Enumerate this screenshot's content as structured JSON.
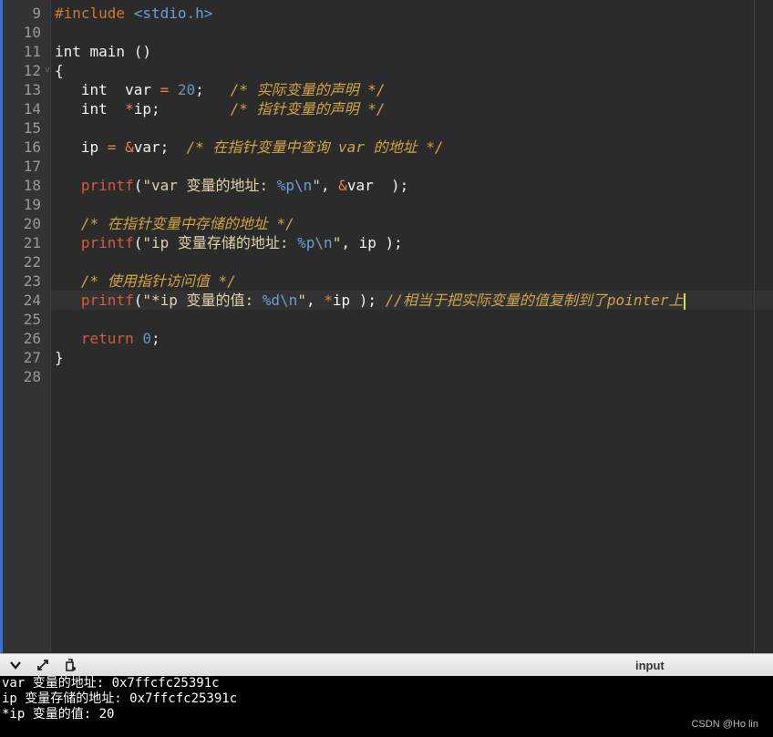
{
  "editor": {
    "lines": [
      {
        "n": "9",
        "segs": [
          {
            "c": "pp",
            "t": "#include "
          },
          {
            "c": "esc",
            "t": "<stdio.h>"
          }
        ]
      },
      {
        "n": "10",
        "segs": []
      },
      {
        "n": "11",
        "segs": [
          {
            "c": "kw",
            "t": "int main ()"
          }
        ]
      },
      {
        "n": "12",
        "fold": true,
        "segs": [
          {
            "c": "kw",
            "t": "{"
          }
        ]
      },
      {
        "n": "13",
        "segs": [
          {
            "c": "kw",
            "t": "   int  var "
          },
          {
            "c": "op",
            "t": "="
          },
          {
            "c": "kw",
            "t": " "
          },
          {
            "c": "num",
            "t": "20"
          },
          {
            "c": "kw",
            "t": ";   "
          },
          {
            "c": "cm",
            "t": "/* 实际变量的声明 */"
          }
        ]
      },
      {
        "n": "14",
        "segs": [
          {
            "c": "kw",
            "t": "   int  "
          },
          {
            "c": "op",
            "t": "*"
          },
          {
            "c": "kw",
            "t": "ip;        "
          },
          {
            "c": "cm",
            "t": "/* 指针变量的声明 */"
          }
        ]
      },
      {
        "n": "15",
        "segs": []
      },
      {
        "n": "16",
        "segs": [
          {
            "c": "kw",
            "t": "   ip "
          },
          {
            "c": "op",
            "t": "="
          },
          {
            "c": "kw",
            "t": " "
          },
          {
            "c": "op",
            "t": "&"
          },
          {
            "c": "kw",
            "t": "var;  "
          },
          {
            "c": "cm",
            "t": "/* 在指针变量中查询 var 的地址 */"
          }
        ]
      },
      {
        "n": "17",
        "segs": []
      },
      {
        "n": "18",
        "segs": [
          {
            "c": "kw",
            "t": "   "
          },
          {
            "c": "fn",
            "t": "printf"
          },
          {
            "c": "kw",
            "t": "("
          },
          {
            "c": "str",
            "t": "\"var 变量的地址: "
          },
          {
            "c": "esc",
            "t": "%p\\n"
          },
          {
            "c": "str",
            "t": "\""
          },
          {
            "c": "kw",
            "t": ", "
          },
          {
            "c": "op",
            "t": "&"
          },
          {
            "c": "kw",
            "t": "var  );"
          }
        ]
      },
      {
        "n": "19",
        "segs": []
      },
      {
        "n": "20",
        "segs": [
          {
            "c": "kw",
            "t": "   "
          },
          {
            "c": "cm",
            "t": "/* 在指针变量中存储的地址 */"
          }
        ]
      },
      {
        "n": "21",
        "segs": [
          {
            "c": "kw",
            "t": "   "
          },
          {
            "c": "fn",
            "t": "printf"
          },
          {
            "c": "kw",
            "t": "("
          },
          {
            "c": "str",
            "t": "\"ip 变量存储的地址: "
          },
          {
            "c": "esc",
            "t": "%p\\n"
          },
          {
            "c": "str",
            "t": "\""
          },
          {
            "c": "kw",
            "t": ", ip );"
          }
        ]
      },
      {
        "n": "22",
        "segs": []
      },
      {
        "n": "23",
        "segs": [
          {
            "c": "kw",
            "t": "   "
          },
          {
            "c": "cm",
            "t": "/* 使用指针访问值 */"
          }
        ]
      },
      {
        "n": "24",
        "cursor": true,
        "segs": [
          {
            "c": "kw",
            "t": "   "
          },
          {
            "c": "fn",
            "t": "printf"
          },
          {
            "c": "kw",
            "t": "("
          },
          {
            "c": "str",
            "t": "\"*ip 变量的值: "
          },
          {
            "c": "esc",
            "t": "%d\\n"
          },
          {
            "c": "str",
            "t": "\""
          },
          {
            "c": "kw",
            "t": ", "
          },
          {
            "c": "op",
            "t": "*"
          },
          {
            "c": "kw",
            "t": "ip ); "
          },
          {
            "c": "cm",
            "t": "//相当于把实际变量的值复制到了pointer上"
          }
        ]
      },
      {
        "n": "25",
        "segs": []
      },
      {
        "n": "26",
        "segs": [
          {
            "c": "kw",
            "t": "   "
          },
          {
            "c": "fn",
            "t": "return"
          },
          {
            "c": "kw",
            "t": " "
          },
          {
            "c": "num",
            "t": "0"
          },
          {
            "c": "kw",
            "t": ";"
          }
        ]
      },
      {
        "n": "27",
        "segs": [
          {
            "c": "kw",
            "t": "}"
          }
        ]
      },
      {
        "n": "28",
        "segs": []
      }
    ]
  },
  "console": {
    "toolbar": {
      "collapse_icon": "chevron-down-icon",
      "expand_icon": "expand-icon",
      "clear_icon": "clear-icon",
      "input_label": "input"
    },
    "output": [
      "var 变量的地址: 0x7ffcfc25391c",
      "ip 变量存储的地址: 0x7ffcfc25391c",
      "*ip 变量的值: 20"
    ]
  },
  "watermark": "CSDN @Ho lin"
}
